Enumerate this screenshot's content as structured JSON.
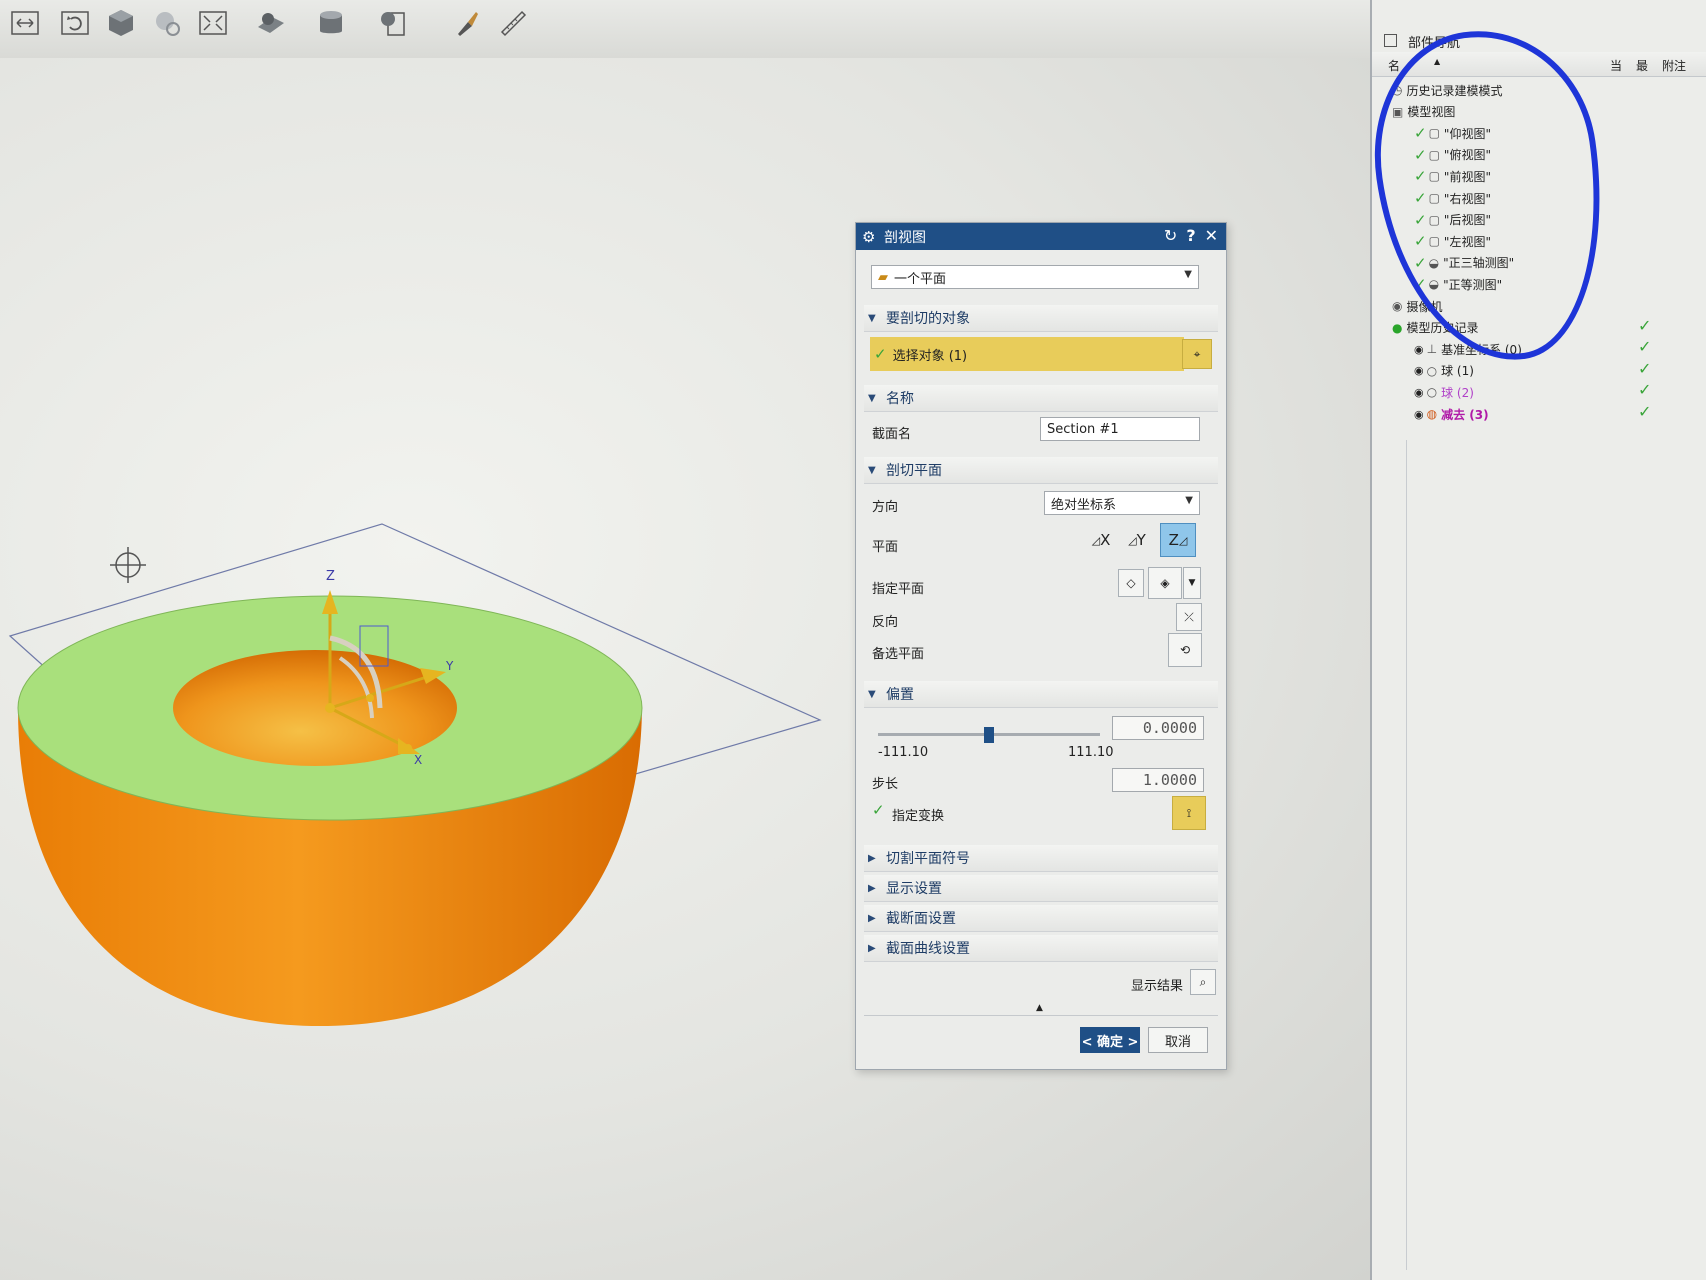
{
  "dialog": {
    "title": "剖视图",
    "type_select": "一个平面",
    "sections": {
      "objects": "要剖切的对象",
      "name": "名称",
      "plane": "剖切平面",
      "offset": "偏置",
      "symbol": "切割平面符号",
      "display": "显示设置",
      "cross_section": "截断面设置",
      "curve": "截面曲线设置"
    },
    "select_object": "选择对象 (1)",
    "section_name_label": "截面名",
    "section_name_value": "Section #1",
    "direction_label": "方向",
    "direction_value": "绝对坐标系",
    "plane_label": "平面",
    "plane_x": "X",
    "plane_y": "Y",
    "plane_z": "Z",
    "specify_plane_label": "指定平面",
    "reverse_label": "反向",
    "alt_plane_label": "备选平面",
    "offset_value": "0.0000",
    "offset_min": "-111.10",
    "offset_max": "111.10",
    "offset_level": 0.5,
    "step_label": "步长",
    "step_value": "1.0000",
    "specify_transform": "指定变换",
    "show_result": "显示结果",
    "ok": "< 确定 >",
    "cancel": "取消"
  },
  "navigator": {
    "title": "部件导航",
    "col_name": "名",
    "col_cur": "当",
    "col_latest": "最",
    "col_note": "附注",
    "tree": [
      {
        "label": "历史记录建模模式",
        "indent": 0,
        "check": false
      },
      {
        "label": "模型视图",
        "indent": 0,
        "check": false
      },
      {
        "label": "\"仰视图\"",
        "indent": 1,
        "check": true
      },
      {
        "label": "\"俯视图\"",
        "indent": 1,
        "check": true
      },
      {
        "label": "\"前视图\"",
        "indent": 1,
        "check": true
      },
      {
        "label": "\"右视图\"",
        "indent": 1,
        "check": true
      },
      {
        "label": "\"后视图\"",
        "indent": 1,
        "check": true
      },
      {
        "label": "\"左视图\"",
        "indent": 1,
        "check": true
      },
      {
        "label": "\"正三轴测图\"",
        "indent": 1,
        "check": true
      },
      {
        "label": "\"正等测图\"",
        "indent": 1,
        "check": true
      },
      {
        "label": "摄像机",
        "indent": 0,
        "check": false
      },
      {
        "label": "模型历史记录",
        "indent": 0,
        "check": false
      },
      {
        "label": "基准坐标系 (0)",
        "indent": 1,
        "check": false
      },
      {
        "label": "球 (1)",
        "indent": 1,
        "check": false
      },
      {
        "label": "球 (2)",
        "indent": 1,
        "check": false
      },
      {
        "label": "减去 (3)",
        "indent": 1,
        "check": false
      }
    ]
  },
  "colors": {
    "title_bar": "#1f4f86",
    "highlight": "#e8cc5a",
    "section_face": "#a8e07a",
    "solid": "#f08a0c",
    "annotation": "#1e35d8",
    "check": "#3aa53a"
  }
}
